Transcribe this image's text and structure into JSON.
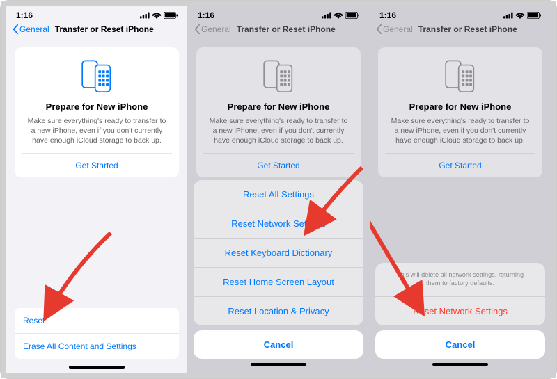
{
  "status": {
    "time": "1:16"
  },
  "nav": {
    "back_label": "General",
    "title": "Transfer or Reset iPhone"
  },
  "card": {
    "title": "Prepare for New iPhone",
    "desc": "Make sure everything's ready to transfer to a new iPhone, even if you don't currently have enough iCloud storage to back up.",
    "button": "Get Started"
  },
  "bottom_list": {
    "reset": "Reset",
    "erase": "Erase All Content and Settings"
  },
  "reset_sheet": {
    "items": [
      "Reset All Settings",
      "Reset Network Settings",
      "Reset Keyboard Dictionary",
      "Reset Home Screen Layout",
      "Reset Location & Privacy"
    ],
    "cancel": "Cancel"
  },
  "confirm_sheet": {
    "message": "This will delete all network settings, returning them to factory defaults.",
    "action": "Reset Network Settings",
    "cancel": "Cancel"
  },
  "colors": {
    "accent": "#007aff",
    "destructive": "#ff3b30"
  }
}
